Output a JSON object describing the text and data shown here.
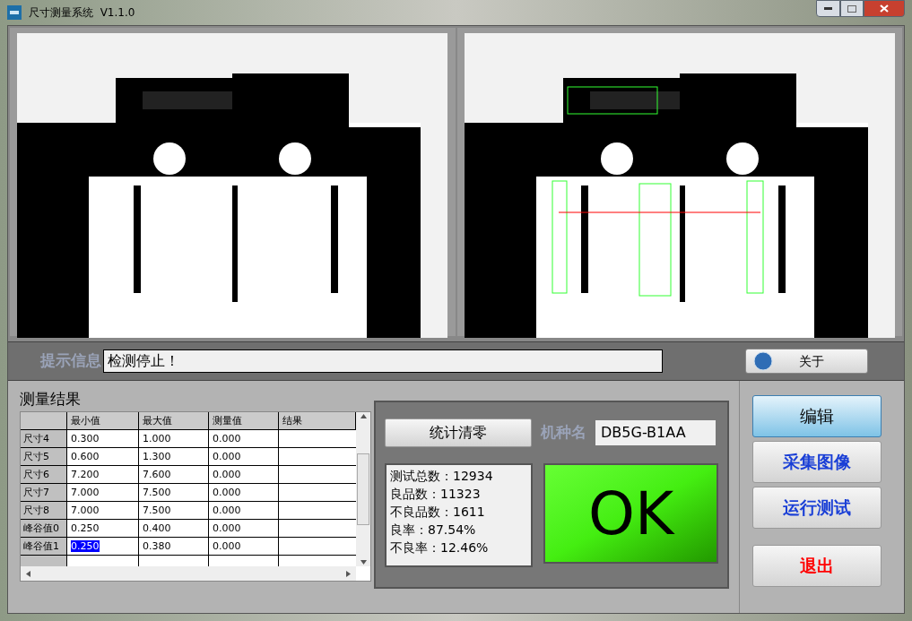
{
  "window": {
    "title": "尺寸测量系统  V1.1.0"
  },
  "prompt": {
    "label": "提示信息",
    "value": "检测停止！"
  },
  "about_button": "关于",
  "results": {
    "title": "测量结果",
    "columns": [
      "最小值",
      "最大值",
      "测量值",
      "结果"
    ],
    "rows": [
      {
        "label": "尺寸4",
        "min": "0.300",
        "max": "1.000",
        "measured": "0.000",
        "min_selected": false
      },
      {
        "label": "尺寸5",
        "min": "0.600",
        "max": "1.300",
        "measured": "0.000",
        "min_selected": false
      },
      {
        "label": "尺寸6",
        "min": "7.200",
        "max": "7.600",
        "measured": "0.000",
        "min_selected": false
      },
      {
        "label": "尺寸7",
        "min": "7.000",
        "max": "7.500",
        "measured": "0.000",
        "min_selected": false
      },
      {
        "label": "尺寸8",
        "min": "7.000",
        "max": "7.500",
        "measured": "0.000",
        "min_selected": false
      },
      {
        "label": "峰谷值0",
        "min": "0.250",
        "max": "0.400",
        "measured": "0.000",
        "min_selected": false
      },
      {
        "label": "峰谷值1",
        "min": "0.250",
        "max": "0.380",
        "measured": "0.000",
        "min_selected": true
      }
    ]
  },
  "reset_button": "统计清零",
  "model": {
    "label": "机种名",
    "value": "DB5G-B1AA"
  },
  "stats": [
    "测试总数：12934",
    "良品数：11323",
    "不良品数：1611",
    "良率：87.54%",
    "不良率：12.46%"
  ],
  "verdict": {
    "text": "OK",
    "kind": "pass"
  },
  "actions": [
    {
      "label": "编辑",
      "selected": true,
      "color": "#000000"
    },
    {
      "label": "采集图像",
      "selected": false,
      "color": "#1a3fd6"
    },
    {
      "label": "运行测试",
      "selected": false,
      "color": "#1a3fd6"
    },
    {
      "label": "退出",
      "selected": false,
      "color": "#ff0000"
    }
  ]
}
